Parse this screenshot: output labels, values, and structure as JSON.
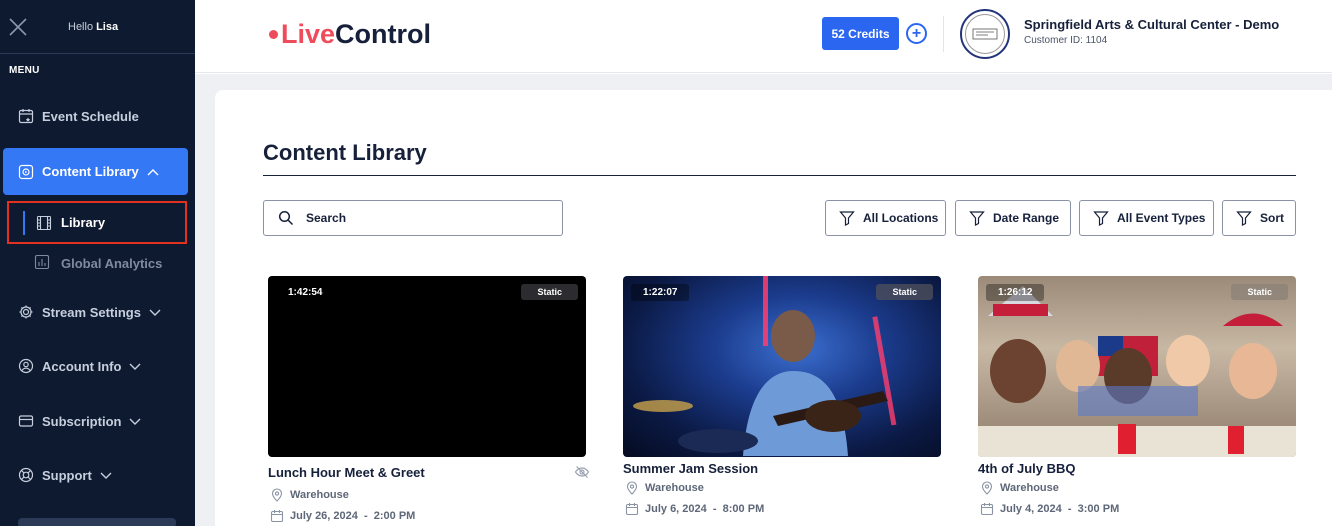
{
  "sidebar": {
    "greeting": "Hello",
    "user_name": "Lisa",
    "menu_label": "MENU",
    "items": [
      {
        "label": "Event Schedule",
        "icon": "calendar-star-icon"
      },
      {
        "label": "Content Library",
        "icon": "play-square-icon",
        "active": true
      },
      {
        "label": "Stream Settings",
        "icon": "gear-icon"
      },
      {
        "label": "Account Info",
        "icon": "user-circle-icon"
      },
      {
        "label": "Subscription",
        "icon": "credit-card-icon"
      },
      {
        "label": "Support",
        "icon": "lifebuoy-icon"
      }
    ],
    "sub_items": [
      {
        "label": "Library",
        "icon": "film-icon",
        "highlighted": true
      },
      {
        "label": "Global Analytics",
        "icon": "bar-chart-icon"
      }
    ]
  },
  "header": {
    "logo_live": "Live",
    "logo_control": "Control",
    "credits_label": "52 Credits",
    "org_name": "Springfield Arts & Cultural Center - Demo",
    "customer_id": "Customer ID: 1104"
  },
  "main": {
    "title": "Content Library",
    "search_placeholder": "Search",
    "filters": [
      "All Locations",
      "Date Range",
      "All Event Types",
      "Sort"
    ]
  },
  "events": [
    {
      "title": "Lunch Hour Meet & Greet",
      "duration": "1:42:54",
      "badge": "Static",
      "location": "Warehouse",
      "date": "July 26, 2024  -  2:00 PM",
      "hidden": true
    },
    {
      "title": "Summer Jam Session",
      "duration": "1:22:07",
      "badge": "Static",
      "location": "Warehouse",
      "date": "July 6, 2024  -  8:00 PM"
    },
    {
      "title": "4th of July BBQ",
      "duration": "1:26:12",
      "badge": "Static",
      "location": "Warehouse",
      "date": "July 4, 2024  -  3:00 PM"
    }
  ],
  "colors": {
    "sidebar_bg": "#0e1a30",
    "accent": "#3578f5",
    "logo_red": "#ee4b5b",
    "highlight_red": "#e2321f"
  }
}
